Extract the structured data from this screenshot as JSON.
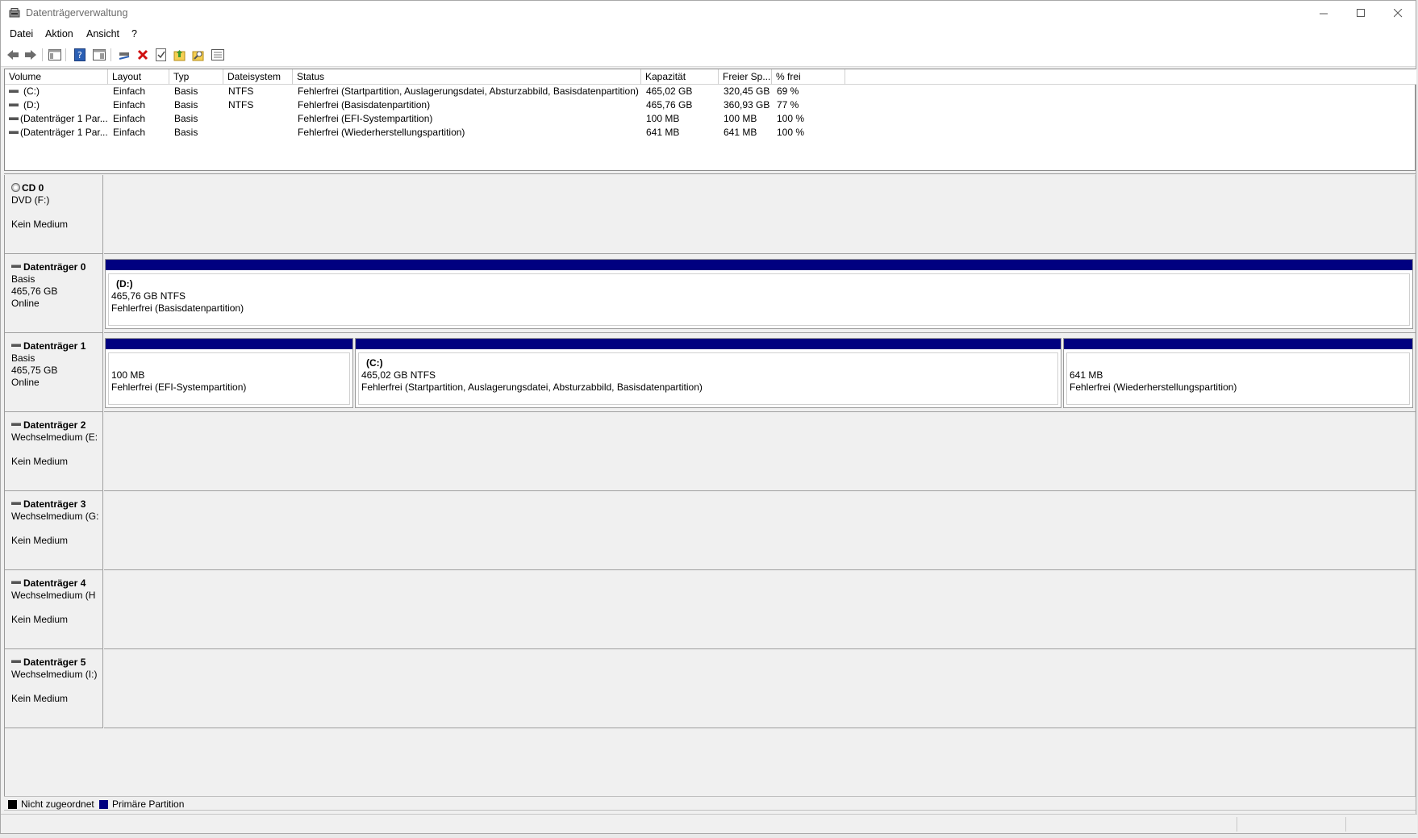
{
  "window": {
    "title": "Datenträgerverwaltung"
  },
  "menu": [
    "Datei",
    "Aktion",
    "Ansicht",
    "?"
  ],
  "toolbar": {
    "icons": [
      "back-arrow-icon",
      "forward-arrow-icon",
      "console-tree-icon",
      "help-icon",
      "properties-list-icon",
      "connect-icon",
      "delete-icon",
      "check-icon",
      "folder-up-icon",
      "folder-search-icon",
      "view-list-icon"
    ]
  },
  "volumes": {
    "columns": [
      "Volume",
      "Layout",
      "Typ",
      "Dateisystem",
      "Status",
      "Kapazität",
      "Freier Sp...",
      "% frei"
    ],
    "rows": [
      [
        "(C:)",
        "Einfach",
        "Basis",
        "NTFS",
        "Fehlerfrei (Startpartition, Auslagerungsdatei, Absturzabbild, Basisdatenpartition)",
        "465,02 GB",
        "320,45 GB",
        "69 %"
      ],
      [
        "(D:)",
        "Einfach",
        "Basis",
        "NTFS",
        "Fehlerfrei (Basisdatenpartition)",
        "465,76 GB",
        "360,93 GB",
        "77 %"
      ],
      [
        "(Datenträger 1 Par...",
        "Einfach",
        "Basis",
        "",
        "Fehlerfrei (EFI-Systempartition)",
        "100 MB",
        "100 MB",
        "100 %"
      ],
      [
        "(Datenträger 1 Par...",
        "Einfach",
        "Basis",
        "",
        "Fehlerfrei (Wiederherstellungspartition)",
        "641 MB",
        "641 MB",
        "100 %"
      ]
    ]
  },
  "disks": [
    {
      "name": "CD 0",
      "line1": "DVD (F:)",
      "line2": "",
      "line3": "Kein Medium",
      "partitions": []
    },
    {
      "name": "Datenträger 0",
      "line1": "Basis",
      "line2": "465,76 GB",
      "line3": "Online",
      "partitions": [
        {
          "name": "(D:)",
          "size": "465,76 GB NTFS",
          "status": "Fehlerfrei (Basisdatenpartition)"
        }
      ]
    },
    {
      "name": "Datenträger 1",
      "line1": "Basis",
      "line2": "465,75 GB",
      "line3": "Online",
      "partitions": [
        {
          "name": "",
          "size": "100 MB",
          "status": "Fehlerfrei (EFI-Systempartition)"
        },
        {
          "name": "(C:)",
          "size": "465,02 GB NTFS",
          "status": "Fehlerfrei (Startpartition, Auslagerungsdatei, Absturzabbild, Basisdatenpartition)"
        },
        {
          "name": "",
          "size": "641 MB",
          "status": "Fehlerfrei (Wiederherstellungspartition)"
        }
      ]
    },
    {
      "name": "Datenträger 2",
      "line1": "Wechselmedium (E:",
      "line2": "",
      "line3": "Kein Medium",
      "partitions": []
    },
    {
      "name": "Datenträger 3",
      "line1": "Wechselmedium (G:",
      "line2": "",
      "line3": "Kein Medium",
      "partitions": []
    },
    {
      "name": "Datenträger 4",
      "line1": "Wechselmedium (H",
      "line2": "",
      "line3": "Kein Medium",
      "partitions": []
    },
    {
      "name": "Datenträger 5",
      "line1": "Wechselmedium (I:)",
      "line2": "",
      "line3": "Kein Medium",
      "partitions": []
    }
  ],
  "legend": [
    {
      "label": "Nicht zugeordnet",
      "color": "#000000"
    },
    {
      "label": "Primäre Partition",
      "color": "#000080"
    }
  ]
}
